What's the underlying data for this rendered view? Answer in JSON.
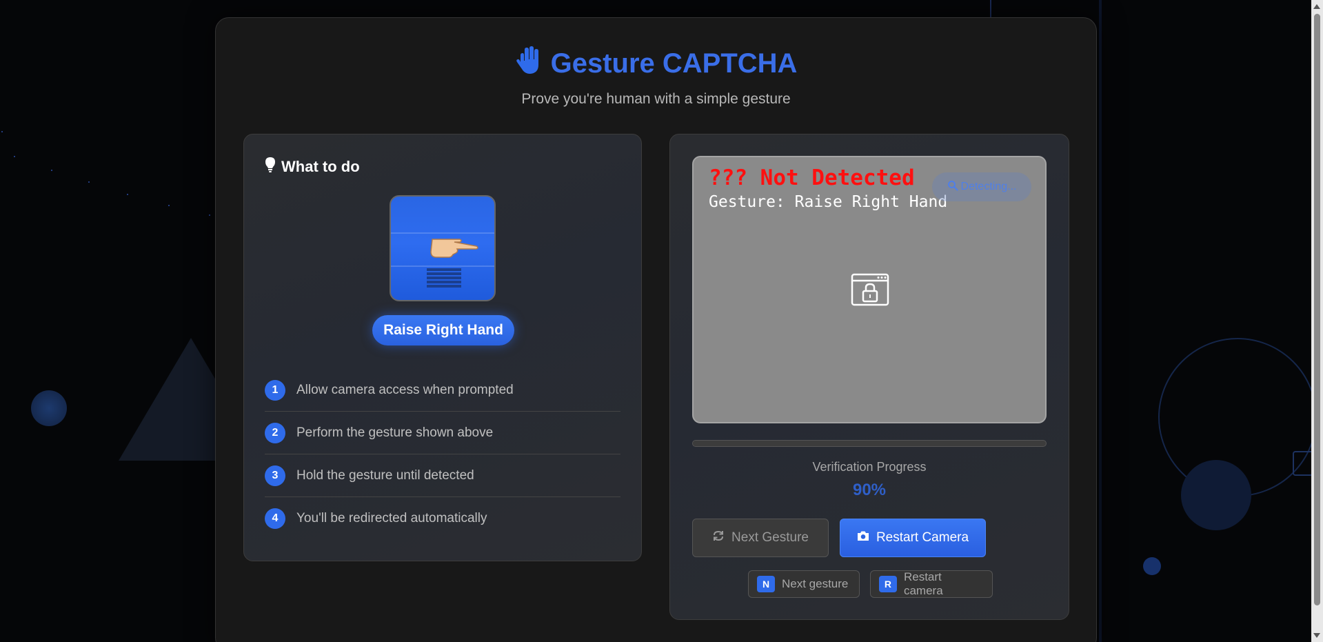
{
  "header": {
    "title": "Gesture CAPTCHA",
    "subtitle": "Prove you're human with a simple gesture",
    "icon": "hand-icon"
  },
  "instructions": {
    "title": "What to do",
    "icon": "lightbulb-icon",
    "gesture_label": "Raise Right Hand",
    "steps": [
      {
        "num": "1",
        "text": "Allow camera access when prompted"
      },
      {
        "num": "2",
        "text": "Perform the gesture shown above"
      },
      {
        "num": "3",
        "text": "Hold the gesture until detected"
      },
      {
        "num": "4",
        "text": "You'll be redirected automatically"
      }
    ]
  },
  "camera": {
    "status_text": "??? Not Detected",
    "gesture_text": "Gesture: Raise Right Hand",
    "detecting_label": "Detecting...",
    "detecting_icon": "search-icon",
    "placeholder_icon": "locked-window-icon"
  },
  "progress": {
    "label": "Verification Progress",
    "value_text": "90%",
    "value": 0.9
  },
  "buttons": {
    "next_gesture": "Next Gesture",
    "restart_camera": "Restart Camera"
  },
  "shortcuts": [
    {
      "key": "N",
      "label": "Next gesture"
    },
    {
      "key": "R",
      "label": "Restart camera"
    }
  ],
  "colors": {
    "accent": "#2f6bea",
    "status_error": "#ff1010",
    "background": "#050608"
  }
}
